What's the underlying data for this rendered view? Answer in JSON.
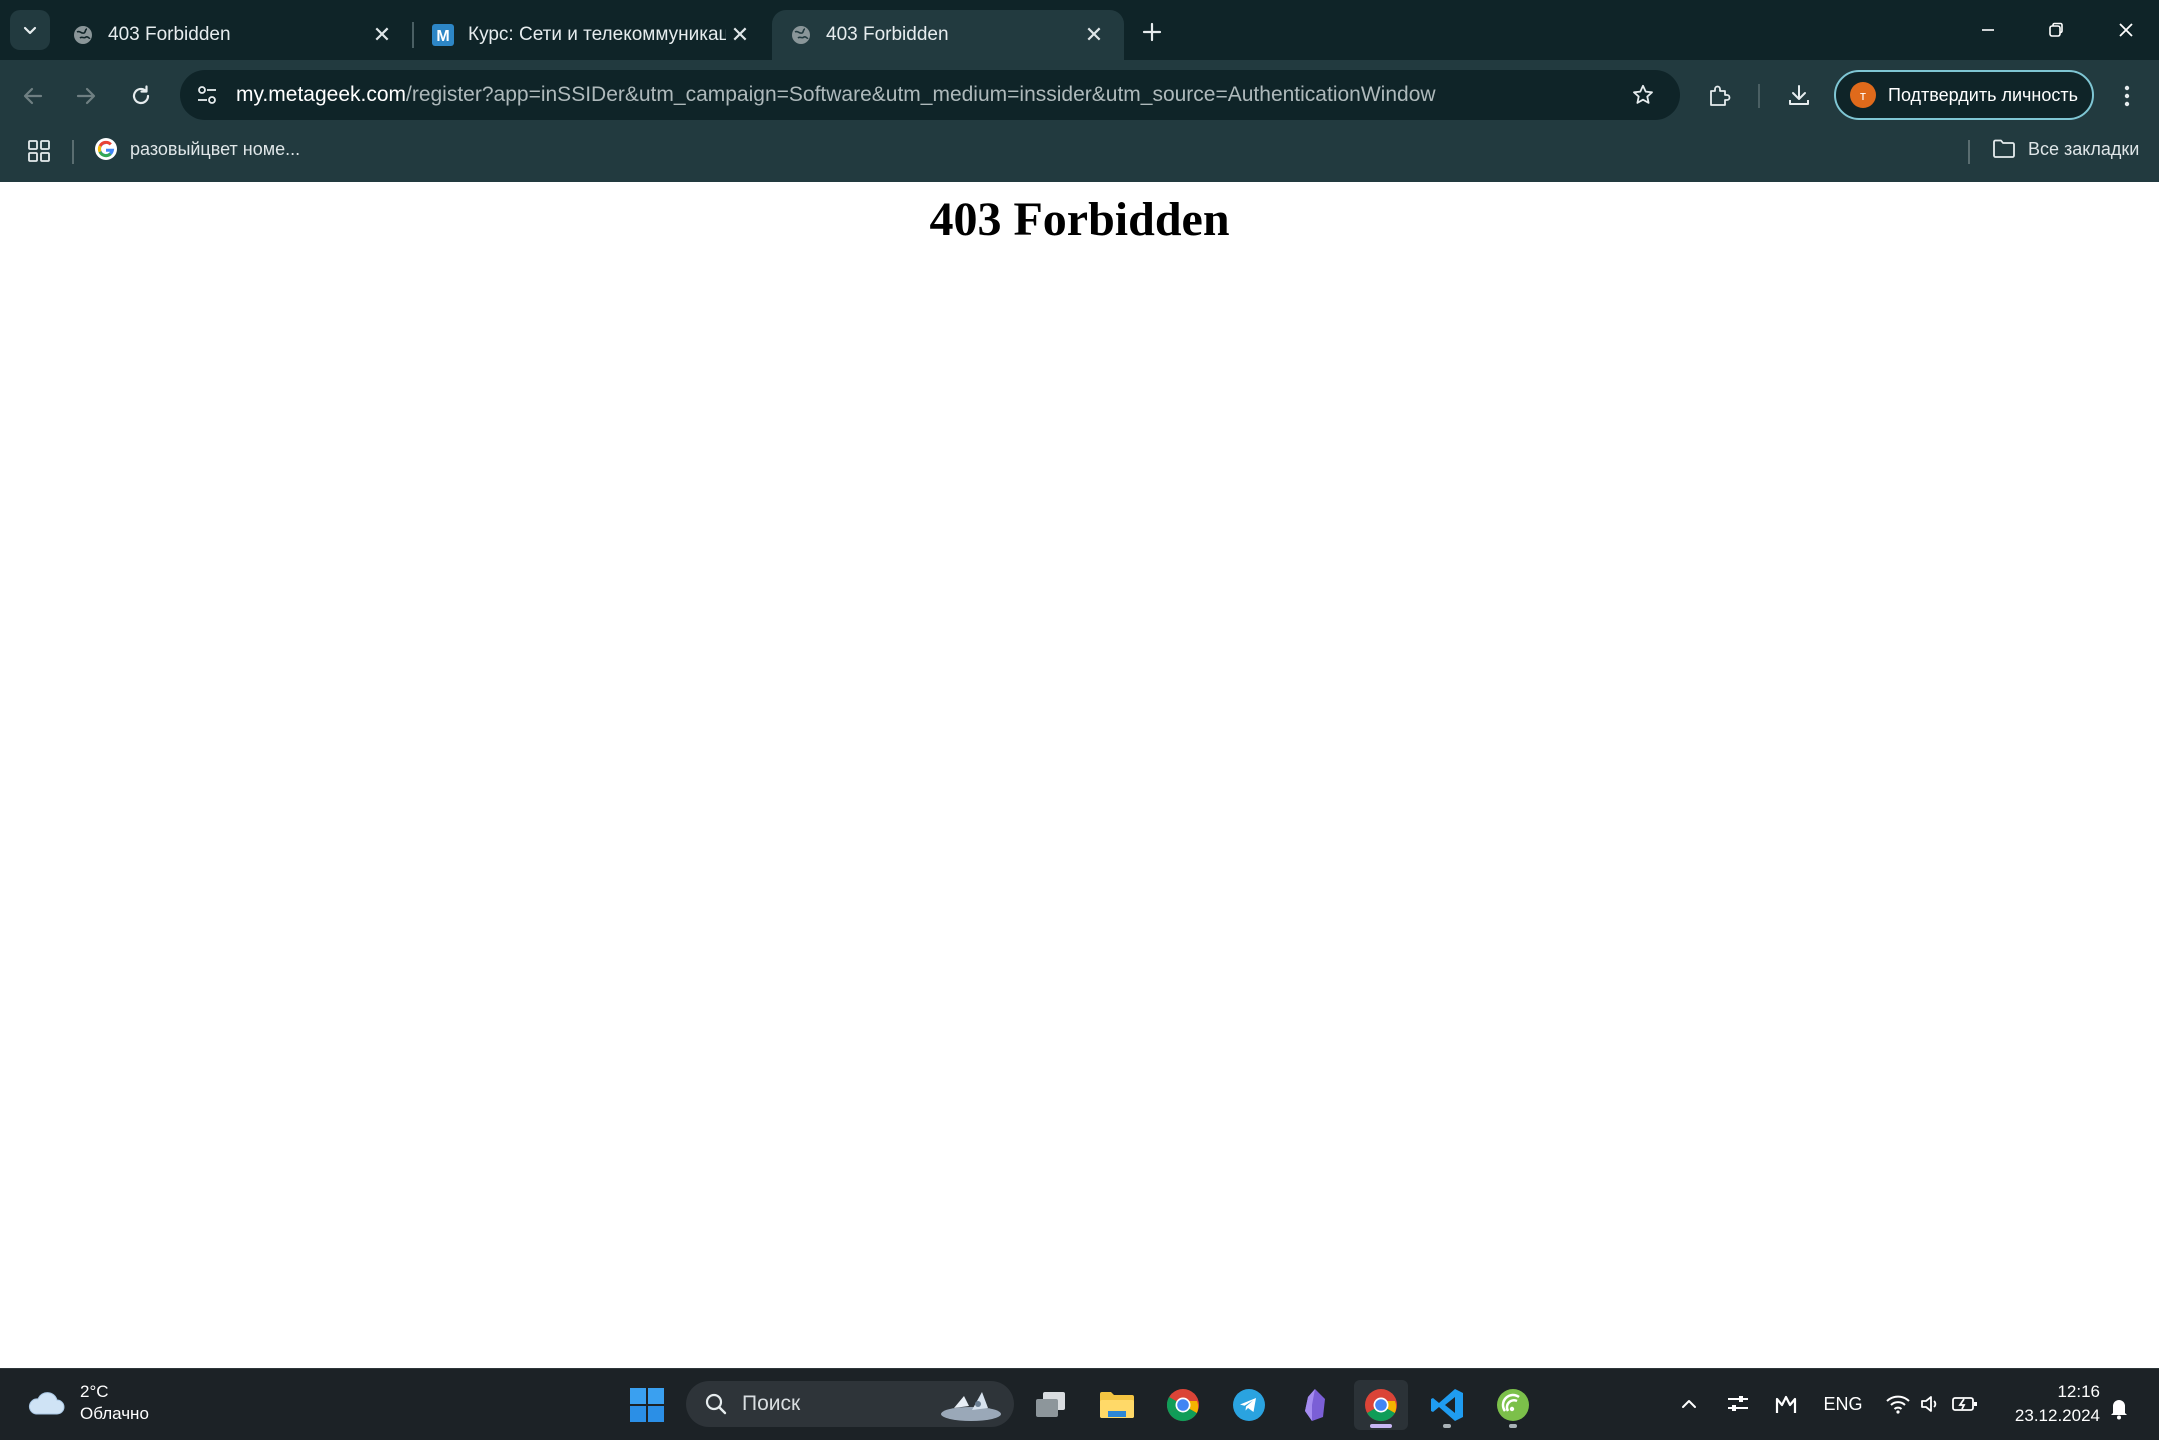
{
  "tabs": [
    {
      "title": "403 Forbidden",
      "active": false
    },
    {
      "title": "Курс: Сети и телекоммуникации",
      "active": false
    },
    {
      "title": "403 Forbidden",
      "active": true
    }
  ],
  "address_bar": {
    "host": "my.metageek.com",
    "path": "/register?app=inSSIDer&utm_campaign=Software&utm_medium=inssider&utm_source=AuthenticationWindow"
  },
  "profile": {
    "button_label": "Подтвердить личность",
    "avatar_letter": "т"
  },
  "bookmarks": {
    "items": [
      {
        "label": "разовыйцвет номе..."
      }
    ],
    "all_bookmarks_label": "Все закладки"
  },
  "page": {
    "heading": "403 Forbidden"
  },
  "taskbar": {
    "weather": {
      "temp": "2°C",
      "condition": "Облачно"
    },
    "search_placeholder": "Поиск",
    "language": "ENG",
    "time": "12:16",
    "date": "23.12.2024"
  },
  "colors": {
    "titlebar": "#0f2428",
    "toolbar": "#223a3f",
    "taskbar": "#1c2226",
    "accent": "#7fc6d4"
  }
}
